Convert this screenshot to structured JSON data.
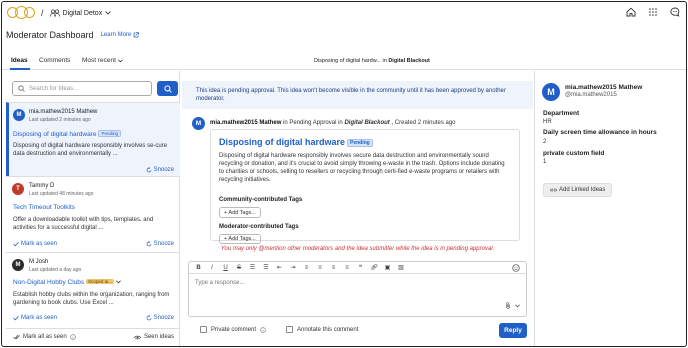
{
  "topbar": {
    "app_name": "Digital Detox",
    "separator": "/"
  },
  "header": {
    "title": "Moderator Dashboard",
    "learn_more": "Learn More"
  },
  "tabs": [
    {
      "label": "Ideas",
      "active": true
    },
    {
      "label": "Comments"
    },
    {
      "label": "Most recent"
    }
  ],
  "breadcrumb": {
    "idea": "Disposing of digital hardw...",
    "in": "in",
    "community": "Digital Blackout"
  },
  "search": {
    "placeholder": "Search for Ideas..."
  },
  "list": [
    {
      "initial": "M",
      "author": "mia.mathew2015 Mathew",
      "time": "Last updated 2 minutes ago",
      "title": "Disposing of digital hardware",
      "badge": "Pending",
      "desc": "Disposing of digital hardware responsibly involves se-cure data destruction and environmentally ...",
      "snooze": "Snooze"
    },
    {
      "initial": "T",
      "author": "Tammy D",
      "time": "Last updated 48 minutes ago",
      "title": "Tech Timeout Toolkits",
      "desc": "Offer a downloadable toolkit with tips, templates, and activities for a successful digital ...",
      "mark_seen": "Mark as seen",
      "snooze": "Snooze"
    },
    {
      "initial": "M",
      "author": "M Josh",
      "time": "Last updated a day ago",
      "title": "Non-Digital Hobby Clubs",
      "badge": "Scoped ai...",
      "desc": "Establish hobby clubs within the organization, ranging from gardening to book clubs. Use Excel ...",
      "mark_seen": "Mark as seen",
      "snooze": "Snooze"
    }
  ],
  "left_footer": {
    "mark_all": "Mark all as seen",
    "seen_ideas": "Seen ideas"
  },
  "notice": "This idea is pending approval. This idea won't become visible in the community until it has been approved by another moderator.",
  "post": {
    "initial": "M",
    "author": "mia.mathew2015 Mathew",
    "in_text": "in Pending Approval in",
    "community": "Digital Blackout",
    "created": ", Created 2 minutes ago",
    "title": "Disposing of digital hardware",
    "badge": "Pending",
    "desc": "Disposing of digital hardware responsibly involves secure data destruction and environmentally sound recycling or donation, and it's crucial to avoid simply throwing e-waste in the trash. Options include donating to charities or schools, selling to resellers or recycling through certi-fied e-waste programs or retailers with recycling initiatives.",
    "community_tags_label": "Community-contributed Tags",
    "moderator_tags_label": "Moderator-contributed Tags",
    "add_tags": "+ Add Tags..."
  },
  "warning": "You may only @mention other moderators and the idea submitter while the idea is in pending approval.",
  "editor": {
    "placeholder": "Type a response...",
    "private_comment": "Private comment",
    "annotate": "Annotate this comment",
    "reply": "Reply"
  },
  "right": {
    "initial": "M",
    "name": "mia.mathew2015 Mathew",
    "handle": "@mia.mathew2015",
    "department_label": "Department",
    "department": "HR",
    "screen_time_label": "Daily screen time allowance in hours",
    "screen_time": "2",
    "custom_label": "private custom field",
    "custom": "1",
    "linked_btn": "Add  Linked Ideas"
  },
  "colors": {
    "accent": "#1f5fc7",
    "logo": "#d9a520",
    "warning": "#cc3333",
    "avatar_t": "#c0392b",
    "avatar_j": "#2c2c2c"
  }
}
